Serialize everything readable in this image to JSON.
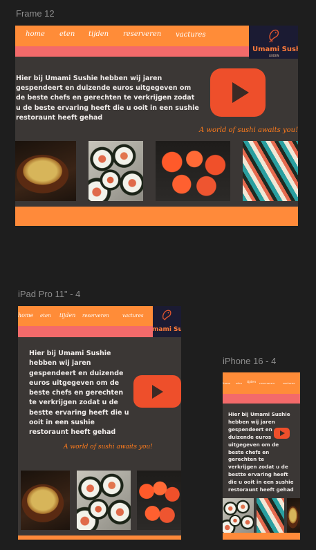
{
  "frames": {
    "desktop": {
      "label": "Frame 12"
    },
    "tablet": {
      "label": "iPad Pro 11\" - 4"
    },
    "phone": {
      "label": "iPhone 16 - 4"
    }
  },
  "nav": {
    "items": [
      "home",
      "eten",
      "tijden",
      "reserveren",
      "vactures"
    ]
  },
  "logo": {
    "name": "Umami Sushi",
    "tablet_name": "mami Su",
    "sub": "LEIDEN"
  },
  "intro": "Hier bij Umami Sushie hebben wij jaren gespendeert en duizende euros uitgegeven om de beste chefs en gerechten te verkrijgen zodat u de beste ervaring heeft die u ooit in een sushie restoraunt heeft gehad",
  "intro_tablet": "Hier bij Umami Sushie hebben wij jaren gespendeert en duizende euros uitgegeven om de beste chefs en gerechten te verkrijgen zodat u de bestte ervaring heeft die u ooit in een sushie restoraunt heeft gehad",
  "intro_phone": "Hier bij Umami Sushie hebben wij jaren gespendeert en duizende euros uitgegeven om de beste chefs en gerechten te verkrijgen zodat u de bestte ervaring heeft die u ooit in een sushie restoraunt heeft gehad",
  "tagline": "A world of sushi awaits you!",
  "icons": {
    "video": "youtube-play-icon",
    "logo": "koi-fish-icon"
  },
  "colors": {
    "nav": "#ff8c38",
    "pink_bar": "#f36a6a",
    "panel": "#3b3735",
    "accent": "#ff7b1c",
    "youtube": "#ee4f2b"
  }
}
